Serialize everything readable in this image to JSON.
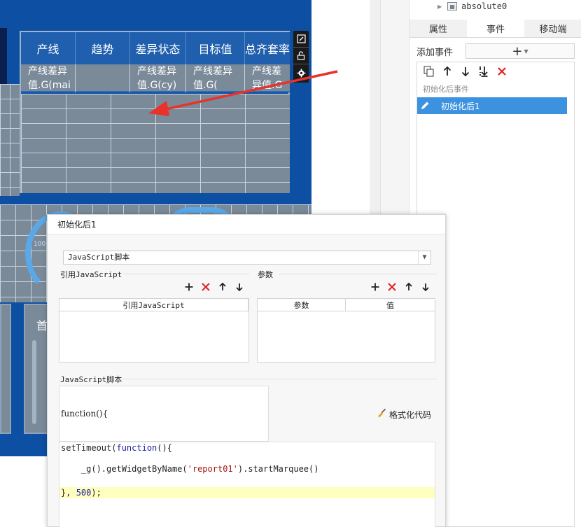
{
  "canvas": {
    "table_headers": [
      "产线",
      "趋势",
      "差异状态",
      "目标值",
      "总齐套率"
    ],
    "table_row1": [
      "产线差异值.G(maik",
      "",
      "产线差异值.G(cy)",
      "产线差异值.G(",
      "产线差异值.G(ate"
    ],
    "gauge_label": "100",
    "lower_card_char": "首",
    "toolbar_icons": [
      "edit-icon",
      "lock-icon",
      "gear-icon"
    ]
  },
  "right_panel": {
    "tree_item": "absolute0",
    "tabs": [
      "属性",
      "事件",
      "移动端"
    ],
    "active_tab": "事件",
    "add_event_label": "添加事件",
    "add_event_button": "+",
    "event_group_label": "初始化后事件",
    "event_item_label": "初始化后1"
  },
  "dialog": {
    "title": "初始化后1",
    "script_type": "JavaScript脚本",
    "ref_js_section": "引用JavaScript",
    "ref_js_column": "引用JavaScript",
    "params_section": "参数",
    "params_columns": [
      "参数",
      "值"
    ],
    "script_section": "JavaScript脚本",
    "function_header": "function(){",
    "format_button": "格式化代码",
    "code": {
      "line1_kw_prefix": "setTimeout(",
      "line1_kw": "function",
      "line1_rest": "(){",
      "line2_prefix": "    _g().getWidgetByName(",
      "line2_str": "'report01'",
      "line2_rest": ").startMarquee()",
      "line3_prefix": "}, ",
      "line3_num": "500",
      "line3_rest": ");"
    }
  },
  "colors": {
    "canvas_blue": "#0d4fa3",
    "grid_gray": "#7a8a99",
    "header_blue": "#1f5fae",
    "selected_blue": "#3d92e0",
    "delete_red": "#e02020",
    "arrow_red": "#e8322a",
    "code_highlight": "#ffffbf"
  }
}
